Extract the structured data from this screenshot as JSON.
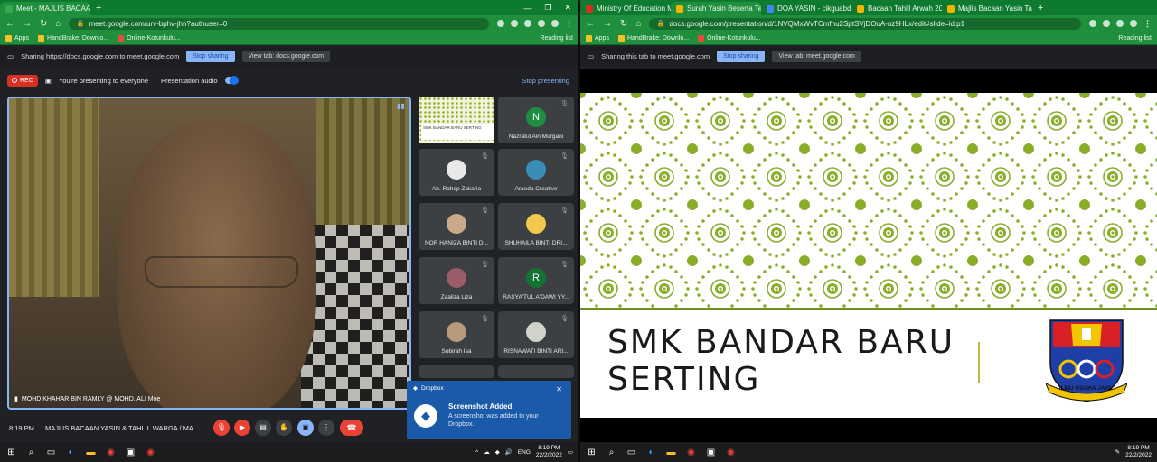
{
  "left": {
    "tabs": [
      {
        "title": "Meet - MAJLIS BACAAN YA...",
        "active": true,
        "color": "#34a853"
      }
    ],
    "url": "meet.google.com/urv-bphv-jhn?authuser=0",
    "bookmarks": [
      "Apps",
      "HandBrake: Downlo...",
      "Online-Kotunkulu..."
    ],
    "reading_list": "Reading list",
    "sharing": {
      "message": "Sharing https://docs.google.com to meet.google.com",
      "stop": "Stop sharing",
      "view": "View tab: docs.google.com"
    },
    "meet": {
      "rec": "REC",
      "presenting": "You're presenting to everyone",
      "audio": "Presentation audio",
      "stop_presenting": "Stop presenting",
      "main_name": "MOHD KHAHAR BIN RAMLY @ MOHD. ALI Moe",
      "participants": [
        {
          "name": "",
          "kind": "slide",
          "slide_text": "SMK BANDAR BARU SERTING"
        },
        {
          "name": "Nazratul Ain Murgani",
          "kind": "letter",
          "letter": "N",
          "color": "#1e8e3e"
        },
        {
          "name": "Ab. Rahop Zakaria",
          "kind": "photo",
          "color": "#e8e8e8"
        },
        {
          "name": "Araeda Creative",
          "kind": "photo",
          "color": "#3a8db5"
        },
        {
          "name": "NOR HANIZA BINTI D...",
          "kind": "photo",
          "color": "#c9a98a"
        },
        {
          "name": "SHUHAILA BINTI DRI...",
          "kind": "photo",
          "color": "#f2c94c"
        },
        {
          "name": "Zaaliza Liza",
          "kind": "photo",
          "color": "#9b5d68"
        },
        {
          "name": "RASYA'TUL A'DAWI YY...",
          "kind": "letter",
          "letter": "R",
          "color": "#137333"
        },
        {
          "name": "Sobirah Isa",
          "kind": "photo",
          "color": "#b89a7a"
        },
        {
          "name": "RISNAWATI BINTI ARI...",
          "kind": "photo",
          "color": "#d0d4c8"
        }
      ],
      "time": "8:19 PM",
      "title": "MAJLIS BACAAN YASIN & TAHLIL WARGA / MA..."
    },
    "toast": {
      "app": "Dropbox",
      "title": "Screenshot Added",
      "body": "A screenshot was added to your Dropbox."
    },
    "tray": {
      "lang": "ENG",
      "time": "8:19 PM",
      "date": "22/2/2022"
    }
  },
  "right": {
    "tabs": [
      {
        "title": "Ministry Of Education Ma...",
        "color": "#d93025"
      },
      {
        "title": "Surah Yasin Beserta Te...",
        "color": "#f4b400",
        "active": true
      },
      {
        "title": "DOA YASIN - cikguabdul...",
        "color": "#4285f4"
      },
      {
        "title": "Bacaan Tahlil Arwah 2020...",
        "color": "#f4b400"
      },
      {
        "title": "Majlis Bacaan Yasin Tahli...",
        "color": "#f4b400"
      }
    ],
    "url": "docs.google.com/presentation/d/1NVQMxWvTCmfnu2SptSVjDOuA-uz9HLx/edit#slide=id.p1",
    "bookmarks": [
      "Apps",
      "HandBrake: Downlo...",
      "Online-Kotunkulu..."
    ],
    "reading_list": "Reading list",
    "sharing": {
      "message": "Sharing this tab to meet.google.com",
      "stop": "Stop sharing",
      "view": "View tab: meet.google.com"
    },
    "slide": {
      "line1": "SMK BANDAR BARU",
      "line2": "SERTING",
      "motto": "ILMU USAHA JAYA"
    },
    "tray": {
      "time": "8:19 PM",
      "date": "22/2/2022"
    }
  }
}
